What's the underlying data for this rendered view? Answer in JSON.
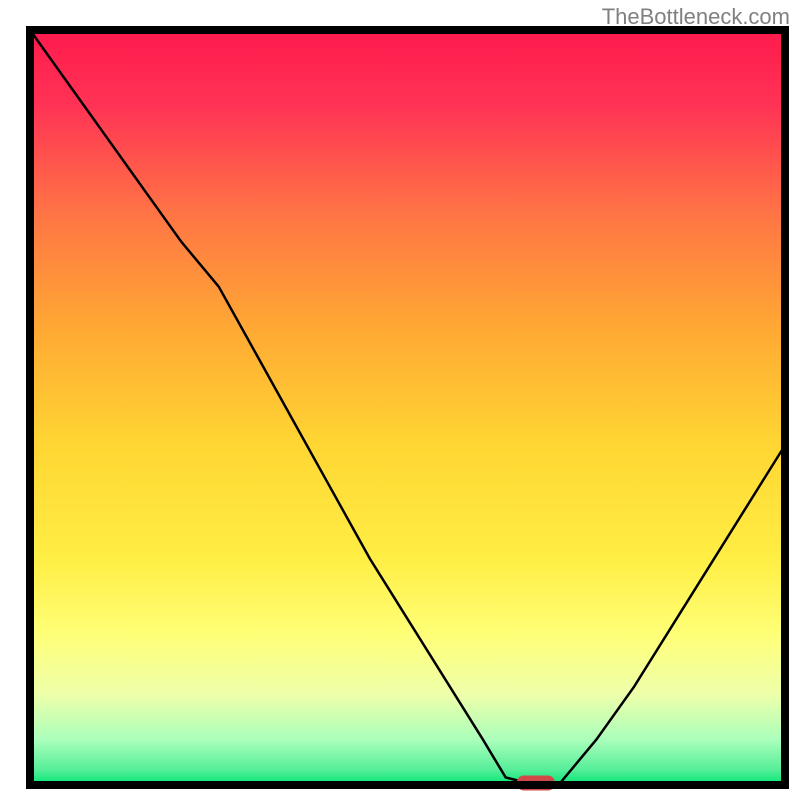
{
  "watermark": "TheBottleneck.com",
  "chart_data": {
    "type": "line",
    "title": "",
    "xlabel": "",
    "ylabel": "",
    "xlim": [
      0,
      100
    ],
    "ylim": [
      0,
      100
    ],
    "x": [
      0,
      5,
      10,
      15,
      20,
      25,
      30,
      35,
      40,
      45,
      50,
      55,
      60,
      63,
      67,
      70,
      75,
      80,
      85,
      90,
      95,
      100
    ],
    "values": [
      100,
      93,
      86,
      79,
      72,
      66,
      57,
      48,
      39,
      30,
      22,
      14,
      6,
      1,
      0,
      0,
      6,
      13,
      21,
      29,
      37,
      45
    ],
    "marker_x": 67,
    "marker_y": 0,
    "colors": {
      "top": "#ff1a4d",
      "mid_upper": "#ff9933",
      "mid": "#ffdd33",
      "mid_lower": "#ffff66",
      "lower": "#ccff99",
      "bottom": "#00e673",
      "line": "#000000",
      "border": "#000000",
      "marker": "#d04848"
    }
  }
}
